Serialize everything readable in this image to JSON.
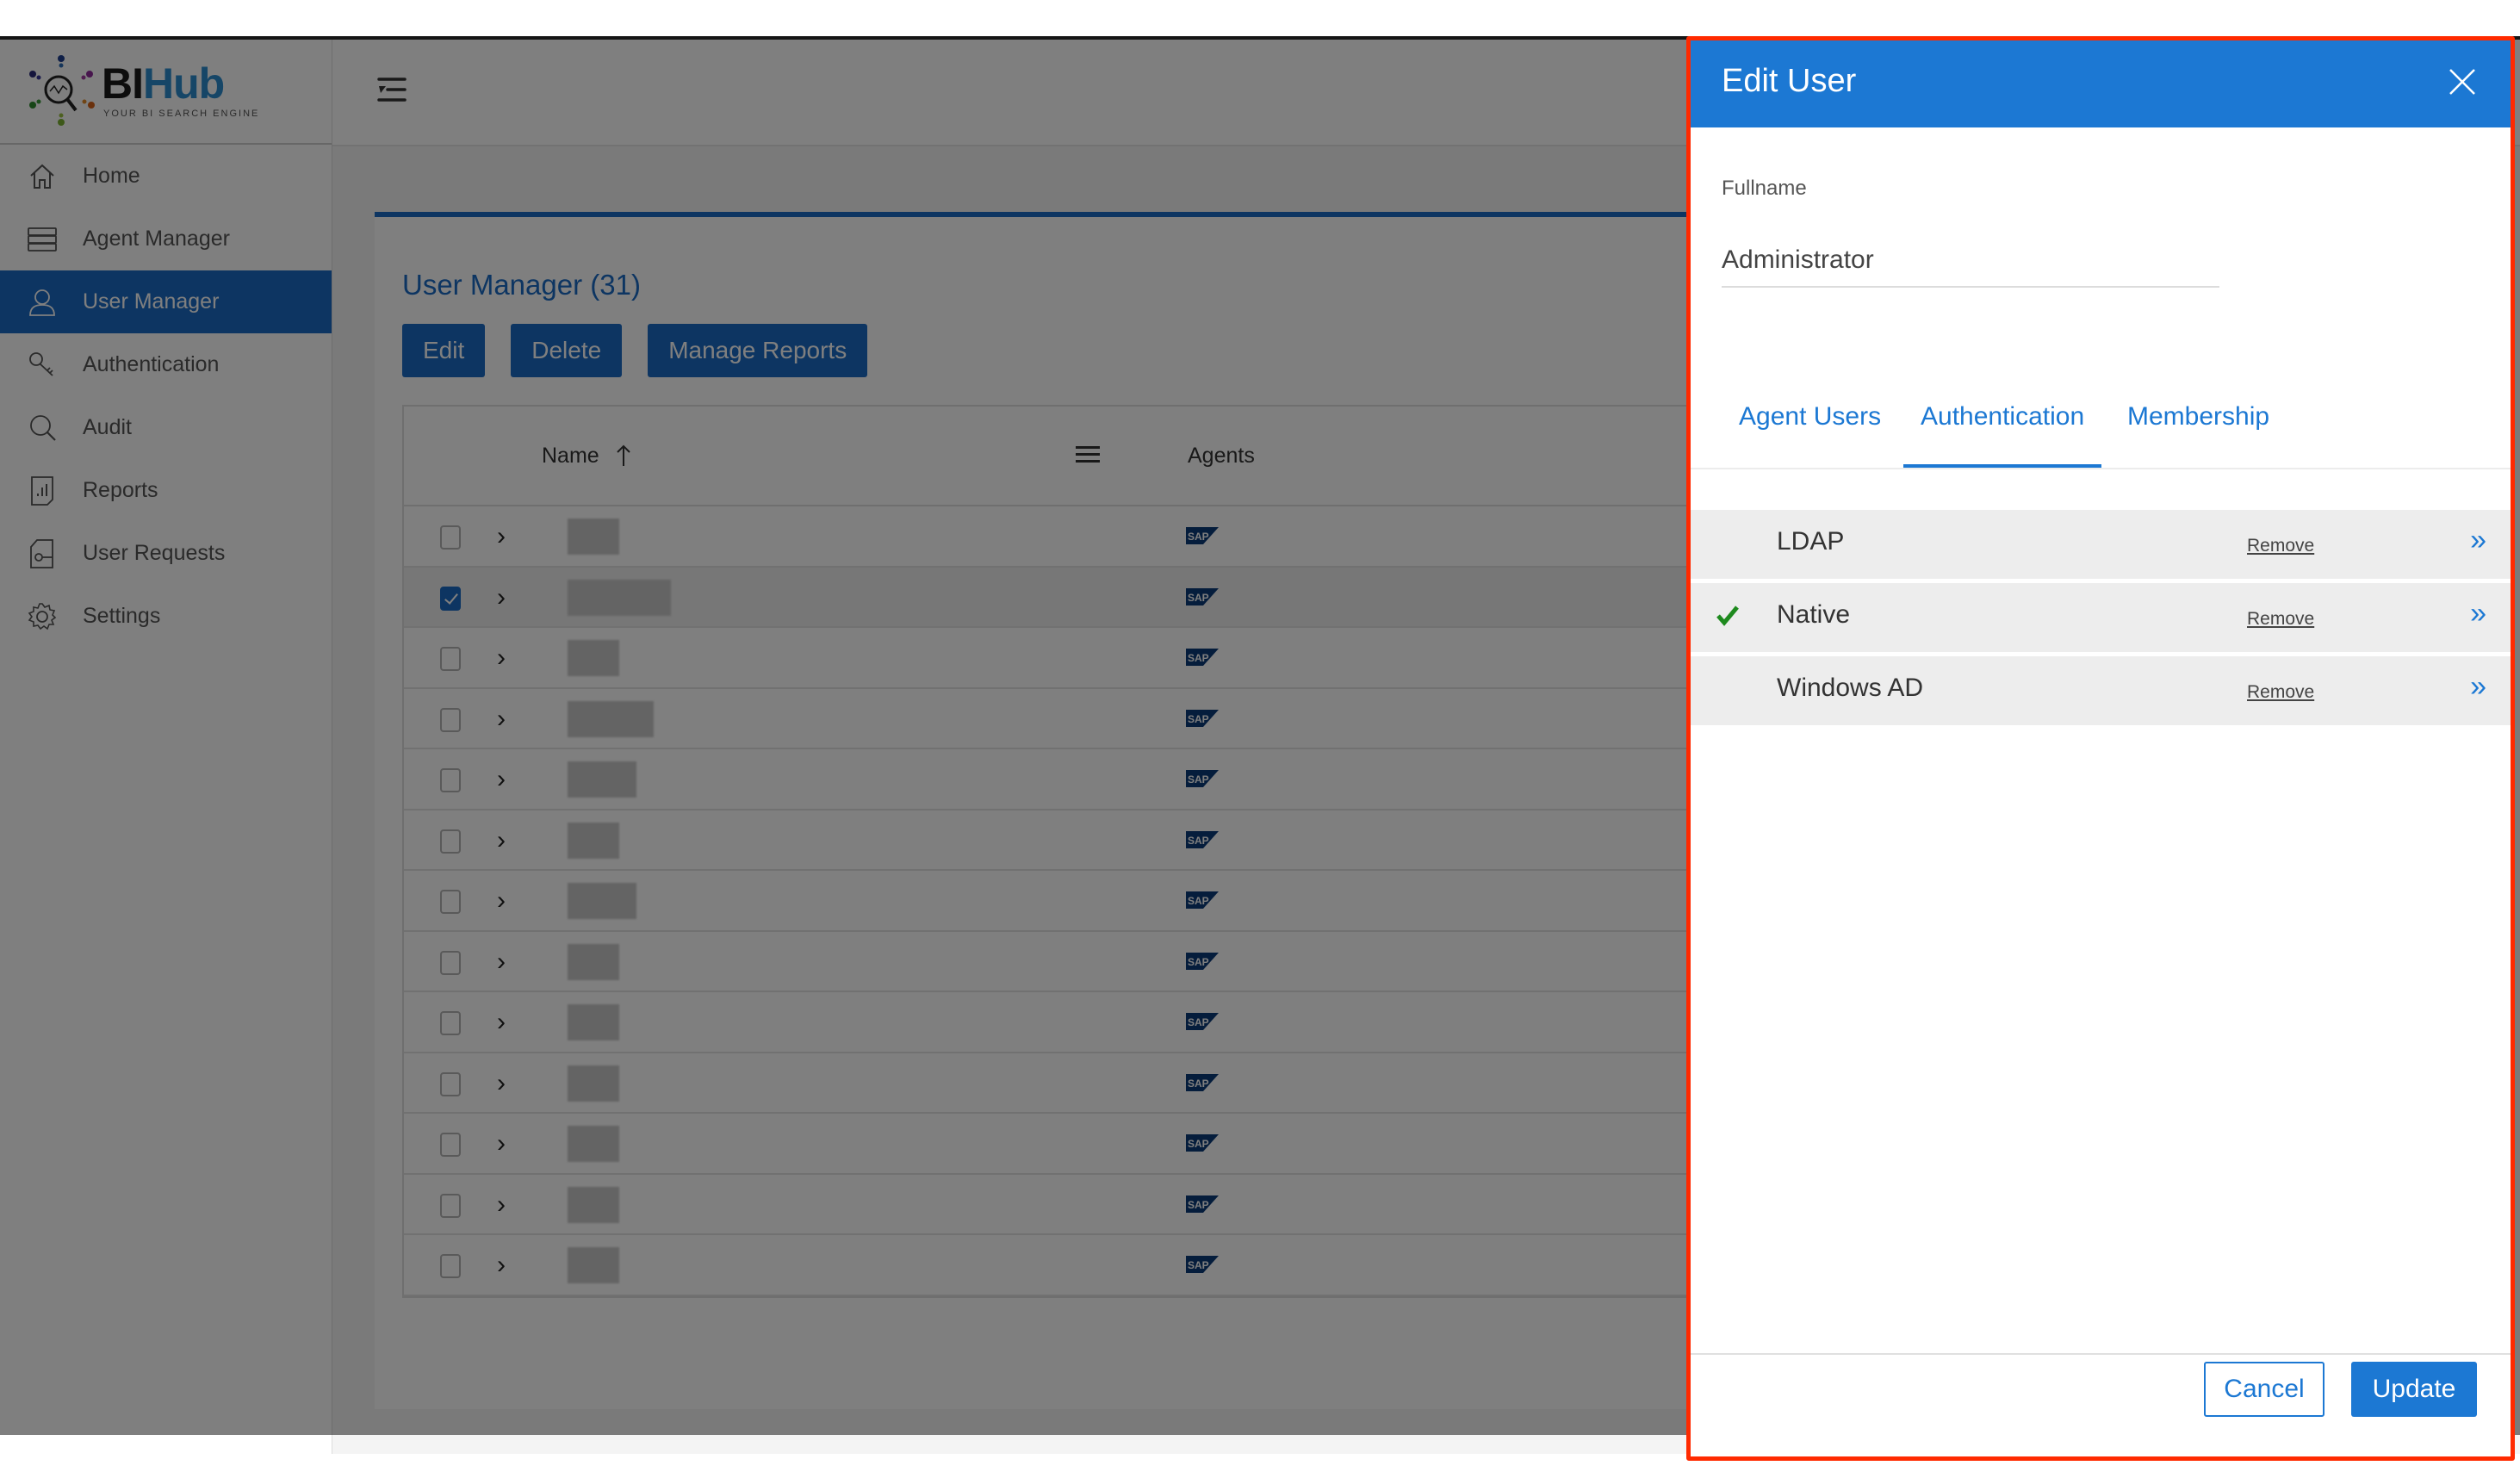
{
  "app": {
    "logo": {
      "brand_dark": "BI",
      "brand_light": "Hub",
      "tagline": "YOUR BI SEARCH ENGINE"
    },
    "colors": {
      "primary": "#1c78d3",
      "sidebar_active": "#1a6bc4",
      "highlight_outline": "#ff2a00",
      "check_green": "#1e8a1e"
    }
  },
  "sidebar": {
    "items": [
      {
        "label": "Home",
        "icon": "home-icon",
        "active": false
      },
      {
        "label": "Agent Manager",
        "icon": "server-icon",
        "active": false
      },
      {
        "label": "User Manager",
        "icon": "user-icon",
        "active": true
      },
      {
        "label": "Authentication",
        "icon": "keys-icon",
        "active": false
      },
      {
        "label": "Audit",
        "icon": "audit-search-icon",
        "active": false
      },
      {
        "label": "Reports",
        "icon": "report-chart-icon",
        "active": false
      },
      {
        "label": "User Requests",
        "icon": "request-key-icon",
        "active": false
      },
      {
        "label": "Settings",
        "icon": "gear-icon",
        "active": false
      }
    ]
  },
  "main": {
    "title": "User Manager (31)",
    "buttons": {
      "edit": "Edit",
      "delete": "Delete",
      "manage_reports": "Manage Reports"
    },
    "table": {
      "columns": {
        "name": "Name",
        "agents": "Agents"
      },
      "sort": "ascending",
      "rows": [
        {
          "checked": false,
          "agent": "SAP"
        },
        {
          "checked": true,
          "agent": "SAP"
        },
        {
          "checked": false,
          "agent": "SAP"
        },
        {
          "checked": false,
          "agent": "SAP"
        },
        {
          "checked": false,
          "agent": "SAP"
        },
        {
          "checked": false,
          "agent": "SAP"
        },
        {
          "checked": false,
          "agent": "SAP"
        },
        {
          "checked": false,
          "agent": "SAP"
        },
        {
          "checked": false,
          "agent": "SAP"
        },
        {
          "checked": false,
          "agent": "SAP"
        },
        {
          "checked": false,
          "agent": "SAP"
        },
        {
          "checked": false,
          "agent": "SAP"
        },
        {
          "checked": false,
          "agent": "SAP"
        }
      ]
    }
  },
  "edit_panel": {
    "title": "Edit User",
    "fullname_label": "Fullname",
    "fullname_value": "Administrator",
    "tabs": [
      {
        "label": "Agent Users",
        "active": false
      },
      {
        "label": "Authentication",
        "active": true
      },
      {
        "label": "Membership",
        "active": false
      }
    ],
    "auth_methods": [
      {
        "name": "LDAP",
        "enabled": false,
        "remove_label": "Remove"
      },
      {
        "name": "Native",
        "enabled": true,
        "remove_label": "Remove"
      },
      {
        "name": "Windows AD",
        "enabled": false,
        "remove_label": "Remove"
      }
    ],
    "cancel_label": "Cancel",
    "update_label": "Update"
  }
}
